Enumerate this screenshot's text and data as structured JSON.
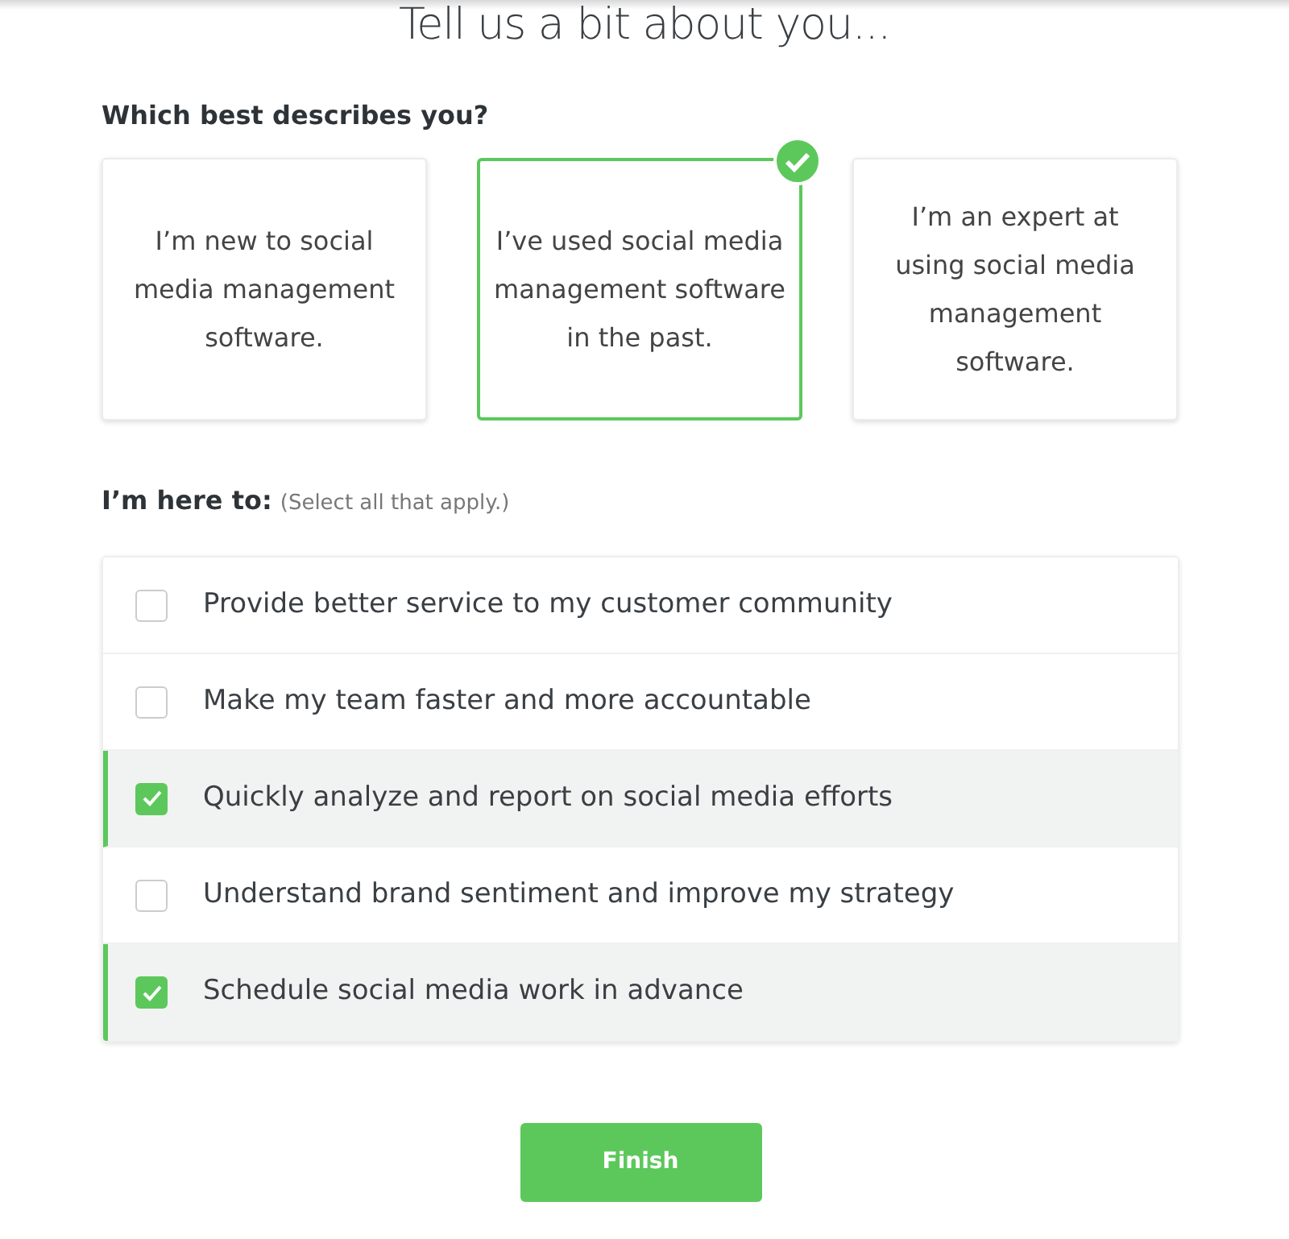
{
  "title": "Tell us a bit about you...",
  "experience": {
    "label": "Which best describes you?",
    "options": [
      {
        "text": "I’m new to social media management software.",
        "selected": false
      },
      {
        "text": "I’ve used social media management software in the past.",
        "selected": true
      },
      {
        "text": "I’m an expert at using social media management software.",
        "selected": false
      }
    ]
  },
  "goals": {
    "label": "I’m here to:",
    "hint": "(Select all that apply.)",
    "items": [
      {
        "text": "Provide better service to my customer community",
        "checked": false
      },
      {
        "text": "Make my team faster and more accountable",
        "checked": false
      },
      {
        "text": "Quickly analyze and report on social media efforts",
        "checked": true
      },
      {
        "text": "Understand brand sentiment and improve my strategy",
        "checked": false
      },
      {
        "text": "Schedule social media work in advance",
        "checked": true
      }
    ]
  },
  "finish_button": "Finish"
}
